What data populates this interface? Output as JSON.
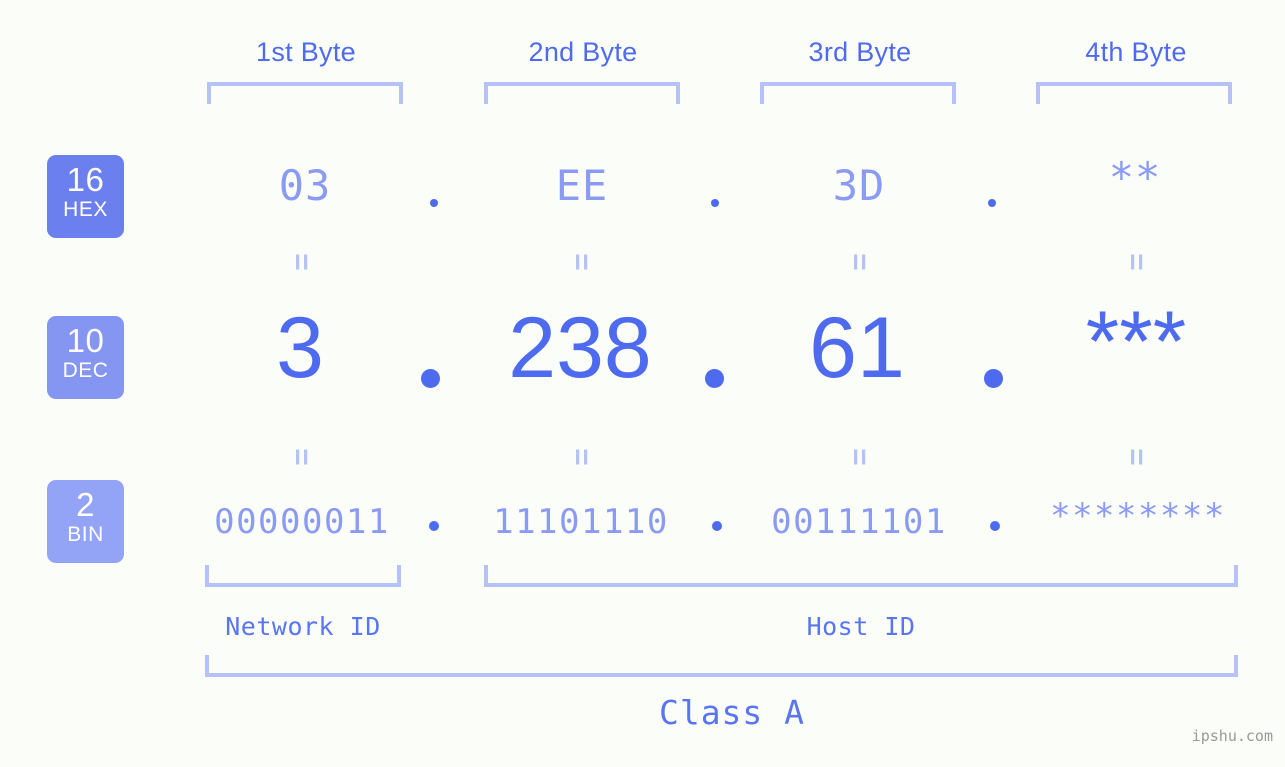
{
  "meta": {
    "watermark": "ipshu.com",
    "background_color": "#fbfdf9",
    "accent_color": "#4e6bef",
    "light_accent_color": "#b6c1f6",
    "muted_accent_color": "#8b9bf3"
  },
  "byte_headers": [
    {
      "label": "1st Byte"
    },
    {
      "label": "2nd Byte"
    },
    {
      "label": "3rd Byte"
    },
    {
      "label": "4th Byte"
    }
  ],
  "rows": [
    {
      "badge_number": "16",
      "badge_unit": "HEX",
      "badge_color": "#6b7fee",
      "values": [
        "03",
        "EE",
        "3D",
        "**"
      ]
    },
    {
      "badge_number": "10",
      "badge_unit": "DEC",
      "badge_color": "#8495f2",
      "values": [
        "3",
        "238",
        "61",
        "***"
      ]
    },
    {
      "badge_number": "2",
      "badge_unit": "BIN",
      "badge_color": "#93a4f7",
      "values": [
        "00000011",
        "11101110",
        "00111101",
        "********"
      ]
    }
  ],
  "separators": {
    "dot": ".",
    "equals": "="
  },
  "footer": {
    "network_id_label": "Network ID",
    "host_id_label": "Host ID",
    "class_label": "Class A"
  }
}
